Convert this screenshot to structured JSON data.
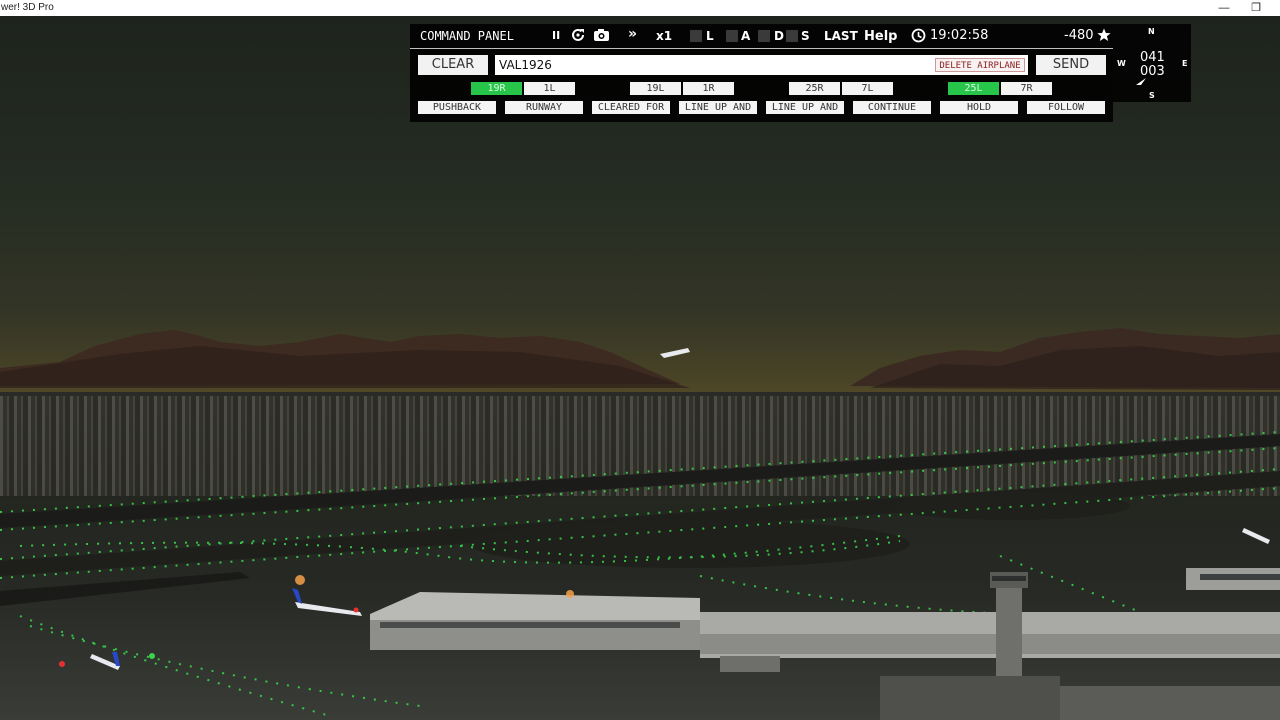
{
  "window": {
    "title": "wer! 3D Pro",
    "minimize_glyph": "—",
    "maximize_glyph": "❐"
  },
  "command_panel": {
    "title": "COMMAND PANEL",
    "pause_glyph": "II",
    "refresh_icon": "refresh-icon",
    "camera_icon": "camera-icon",
    "fast_forward_glyph": "»",
    "speed": "x1",
    "toggle_labels": [
      "L",
      "A",
      "D",
      "S"
    ],
    "last_label": "LAST",
    "help_label": "Help",
    "clock_icon": "clock-icon",
    "time": "19:02:58",
    "score": "-480",
    "star_icon": "star-icon",
    "clear_label": "CLEAR",
    "callsign_value": "VAL1926",
    "delete_label": "DELETE AIRPLANE",
    "send_label": "SEND",
    "runways": [
      "19R",
      "1L",
      "19L",
      "1R",
      "25R",
      "7L",
      "25L",
      "7R"
    ],
    "selected_runways": [
      "19R",
      "25L"
    ],
    "selected_color": "#27c54a",
    "commands": [
      "PUSHBACK",
      "RUNWAY",
      "CLEARED FOR",
      "LINE UP AND",
      "LINE UP AND",
      "CONTINUE",
      "HOLD",
      "FOLLOW"
    ]
  },
  "compass": {
    "north": "N",
    "south": "S",
    "west": "W",
    "east": "E",
    "heading": "041",
    "wind": "003",
    "wind_arrow_icon": "wind-arrow-icon"
  }
}
